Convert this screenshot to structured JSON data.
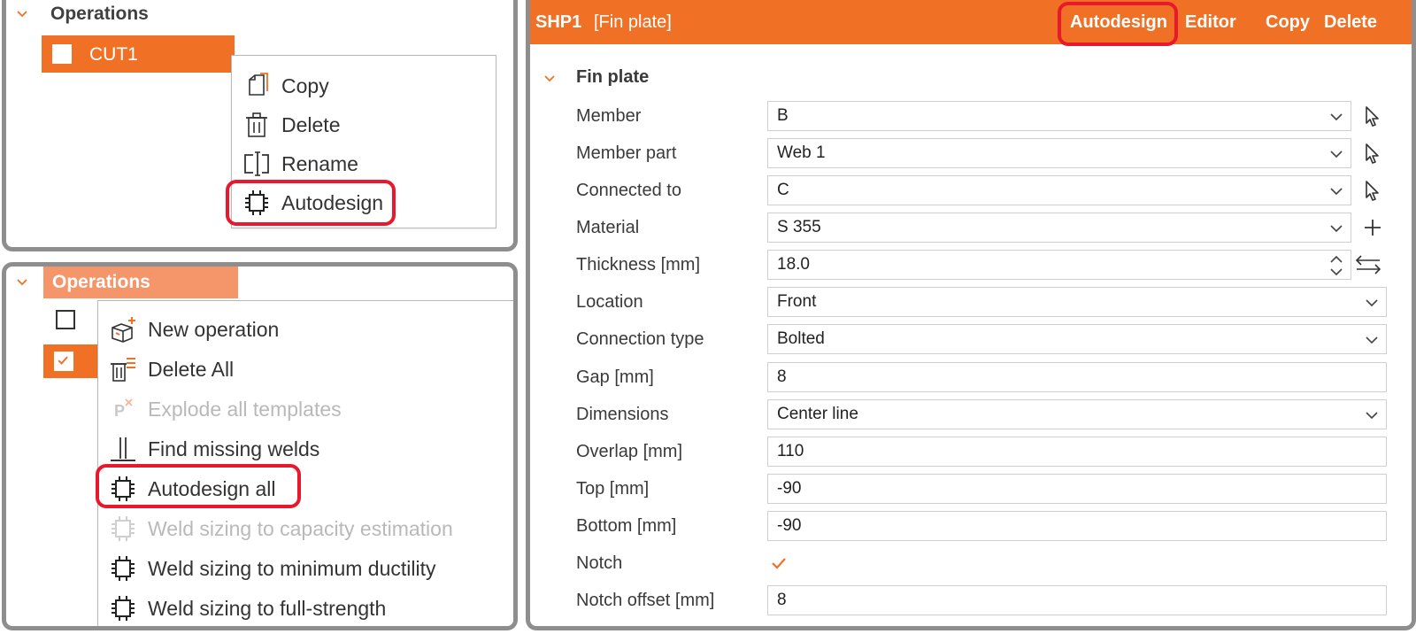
{
  "top_left": {
    "tree_title": "Operations",
    "selected_item": "CUT1",
    "menu": [
      {
        "label": "Copy",
        "icon": "copy-icon"
      },
      {
        "label": "Delete",
        "icon": "trash-icon"
      },
      {
        "label": "Rename",
        "icon": "rename-icon"
      },
      {
        "label": "Autodesign",
        "icon": "chip-icon"
      }
    ]
  },
  "bottom_left": {
    "tree_title": "Operations",
    "menu": [
      {
        "label": "New operation",
        "icon": "new-operation-icon",
        "enabled": true
      },
      {
        "label": "Delete All",
        "icon": "delete-all-icon",
        "enabled": true
      },
      {
        "label": "Explode all templates",
        "icon": "explode-icon",
        "enabled": false
      },
      {
        "label": "Find missing welds",
        "icon": "weld-icon",
        "enabled": true
      },
      {
        "label": "Autodesign all",
        "icon": "chip-icon",
        "enabled": true
      },
      {
        "label": "Weld sizing to capacity estimation",
        "icon": "chip-icon",
        "enabled": false
      },
      {
        "label": "Weld sizing to minimum ductility",
        "icon": "chip-icon",
        "enabled": true
      },
      {
        "label": "Weld sizing to full-strength",
        "icon": "chip-icon",
        "enabled": true
      }
    ]
  },
  "right": {
    "header": {
      "id": "SHP1",
      "type": "[Fin plate]",
      "actions": [
        "Autodesign",
        "Editor",
        "Copy",
        "Delete"
      ]
    },
    "section": "Fin plate",
    "properties": [
      {
        "label": "Member",
        "value": "B",
        "control": "select",
        "side": "pick-icon"
      },
      {
        "label": "Member part",
        "value": "Web 1",
        "control": "select",
        "side": "pick-icon"
      },
      {
        "label": "Connected to",
        "value": "C",
        "control": "select",
        "side": "pick-icon"
      },
      {
        "label": "Material",
        "value": "S 355",
        "control": "select",
        "side": "plus-icon"
      },
      {
        "label": "Thickness [mm]",
        "value": "18.0",
        "control": "spinner",
        "side": "swap-icon"
      },
      {
        "label": "Location",
        "value": "Front",
        "control": "select-wide"
      },
      {
        "label": "Connection type",
        "value": "Bolted",
        "control": "select-wide"
      },
      {
        "label": "Gap [mm]",
        "value": "8",
        "control": "text"
      },
      {
        "label": "Dimensions",
        "value": "Center line",
        "control": "select-wide"
      },
      {
        "label": "Overlap [mm]",
        "value": "110",
        "control": "text"
      },
      {
        "label": "Top [mm]",
        "value": "-90",
        "control": "text"
      },
      {
        "label": "Bottom [mm]",
        "value": "-90",
        "control": "text"
      },
      {
        "label": "Notch",
        "value": "",
        "control": "checkbox",
        "checked": true
      },
      {
        "label": "Notch offset [mm]",
        "value": "8",
        "control": "text"
      }
    ],
    "colors": {
      "accent": "#f07126",
      "highlight": "#e8192c"
    }
  }
}
